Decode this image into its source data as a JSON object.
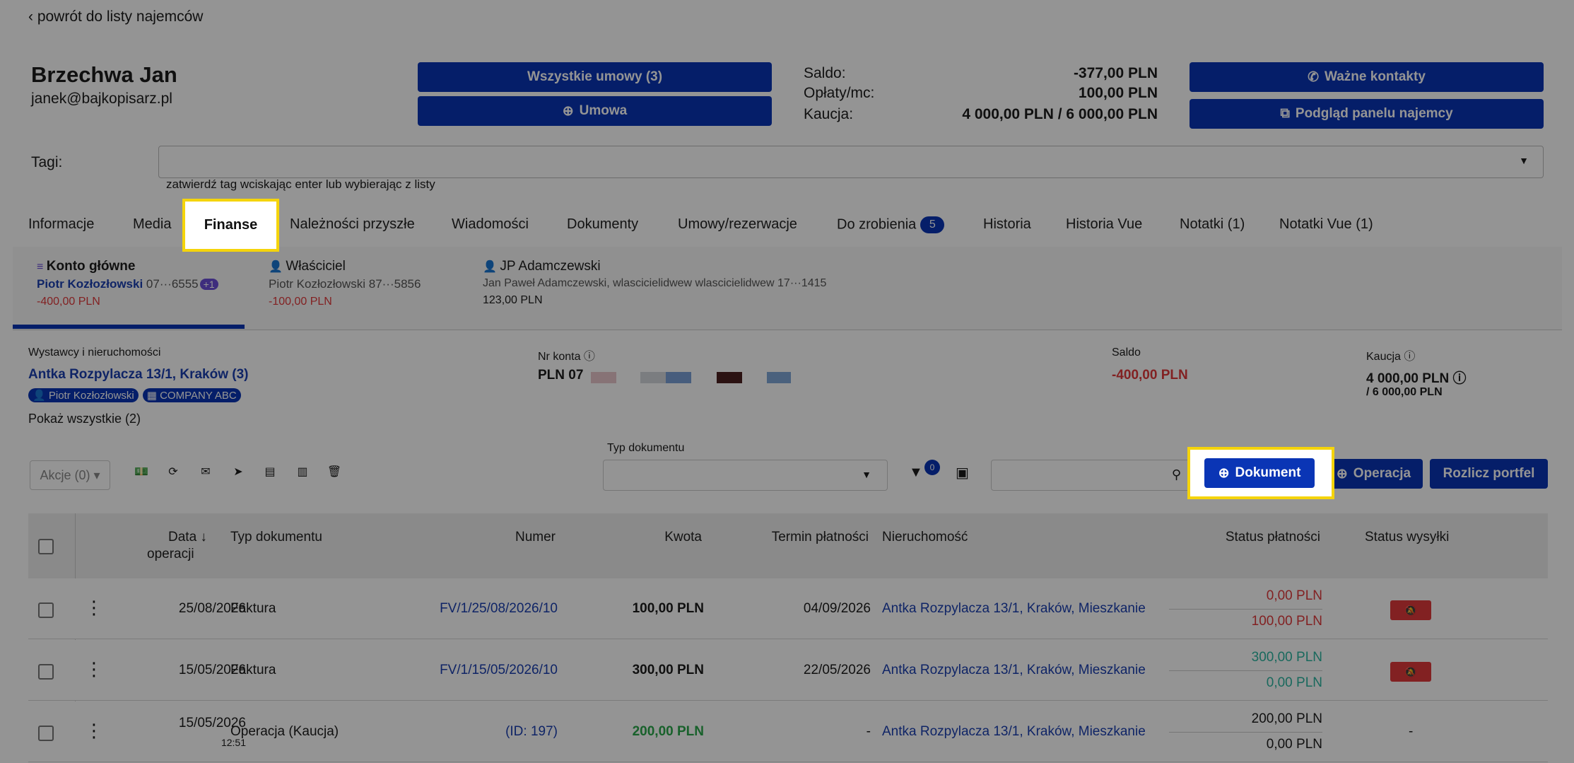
{
  "back_link": "powrót do listy najemców",
  "tenant": {
    "name": "Brzechwa Jan",
    "email": "janek@bajkopisarz.pl"
  },
  "buttons": {
    "all_contracts": "Wszystkie umowy (3)",
    "contract": "Umowa",
    "important_contacts": "Ważne kontakty",
    "tenant_panel": "Podgląd panelu najemcy"
  },
  "summary": {
    "saldo_label": "Saldo:",
    "saldo_value": "-377,00 PLN",
    "fees_label": "Opłaty/mc:",
    "fees_value": "100,00 PLN",
    "deposit_label": "Kaucja:",
    "deposit_value": "4 000,00 PLN / 6 000,00 PLN"
  },
  "tags": {
    "label": "Tagi:",
    "hint": "zatwierdź tag wciskając enter lub wybierając z listy"
  },
  "tabs": [
    {
      "label": "Informacje"
    },
    {
      "label": "Media"
    },
    {
      "label": "Finanse"
    },
    {
      "label": "Należności przyszłe"
    },
    {
      "label": "Wiadomości"
    },
    {
      "label": "Dokumenty"
    },
    {
      "label": "Umowy/rezerwacje"
    },
    {
      "label": "Do zrobienia"
    },
    {
      "label": "Historia"
    },
    {
      "label": "Historia Vue"
    },
    {
      "label": "Notatki (1)"
    },
    {
      "label": "Notatki Vue (1)"
    }
  ],
  "todo_count": "5",
  "accounts": [
    {
      "name": "Konto główne",
      "person": "Piotr Kozłozłowski",
      "acct": "07···6555",
      "extra": "+1",
      "amount": "-400,00 PLN"
    },
    {
      "name": "Właściciel",
      "person": "Piotr Kozłozłowski",
      "acct": "87···5856",
      "amount": "-100,00 PLN"
    },
    {
      "name": "JP Adamczewski",
      "person": "Jan Paweł Adamczewski, wlascicielidwew wlascicielidwew 17···1415",
      "amount": "123,00 PLN"
    }
  ],
  "details": {
    "issuers_label": "Wystawcy i nieruchomości",
    "property": "Antka Rozpylacza 13/1, Kraków (3)",
    "chip_person": "Piotr Kozłozłowski",
    "chip_company": "COMPANY ABC",
    "show_all": "Pokaż wszystkie (2)",
    "account_label": "Nr konta",
    "account_prefix": "PLN 07",
    "saldo_label": "Saldo",
    "saldo_value": "-400,00 PLN",
    "deposit_label": "Kaucja",
    "deposit_value": "4 000,00 PLN",
    "deposit_total": "/ 6 000,00 PLN"
  },
  "toolbar": {
    "actions": "Akcje (0)",
    "doc_type_label": "Typ dokumentu",
    "filter_count": "0",
    "add_document": "Dokument",
    "add_operation": "Operacja",
    "settle": "Rozlicz portfel"
  },
  "table": {
    "headers": {
      "date": "Data",
      "date2": "operacji",
      "type": "Typ dokumentu",
      "number": "Numer",
      "amount": "Kwota",
      "due": "Termin płatności",
      "property": "Nieruchomość",
      "pay_status": "Status płatności",
      "send_status": "Status wysyłki"
    },
    "rows": [
      {
        "date": "25/08/2026",
        "time": "",
        "type": "Faktura",
        "number": "FV/1/25/08/2026/10",
        "amount": "100,00 PLN",
        "due": "04/09/2026",
        "property": "Antka Rozpylacza 13/1, Kraków, Mieszkanie",
        "paid": "0,00 PLN",
        "total": "100,00 PLN",
        "send": ""
      },
      {
        "date": "15/05/2026",
        "time": "",
        "type": "Faktura",
        "number": "FV/1/15/05/2026/10",
        "amount": "300,00 PLN",
        "due": "22/05/2026",
        "property": "Antka Rozpylacza 13/1, Kraków, Mieszkanie",
        "paid": "300,00 PLN",
        "total": "0,00 PLN",
        "send": ""
      },
      {
        "date": "15/05/2026",
        "time": "12:51",
        "type": "Operacja (Kaucja)",
        "number": "(ID: 197)",
        "amount": "200,00 PLN",
        "due": "-",
        "property": "Antka Rozpylacza 13/1, Kraków, Mieszkanie",
        "paid": "200,00 PLN",
        "total": "0,00 PLN",
        "send": "-"
      }
    ]
  },
  "colors": {
    "primary": "#0a35b5",
    "negative": "#e0393c",
    "positive": "#2aa84a",
    "teal": "#2bb5a0",
    "highlight": "#f5d40b"
  }
}
